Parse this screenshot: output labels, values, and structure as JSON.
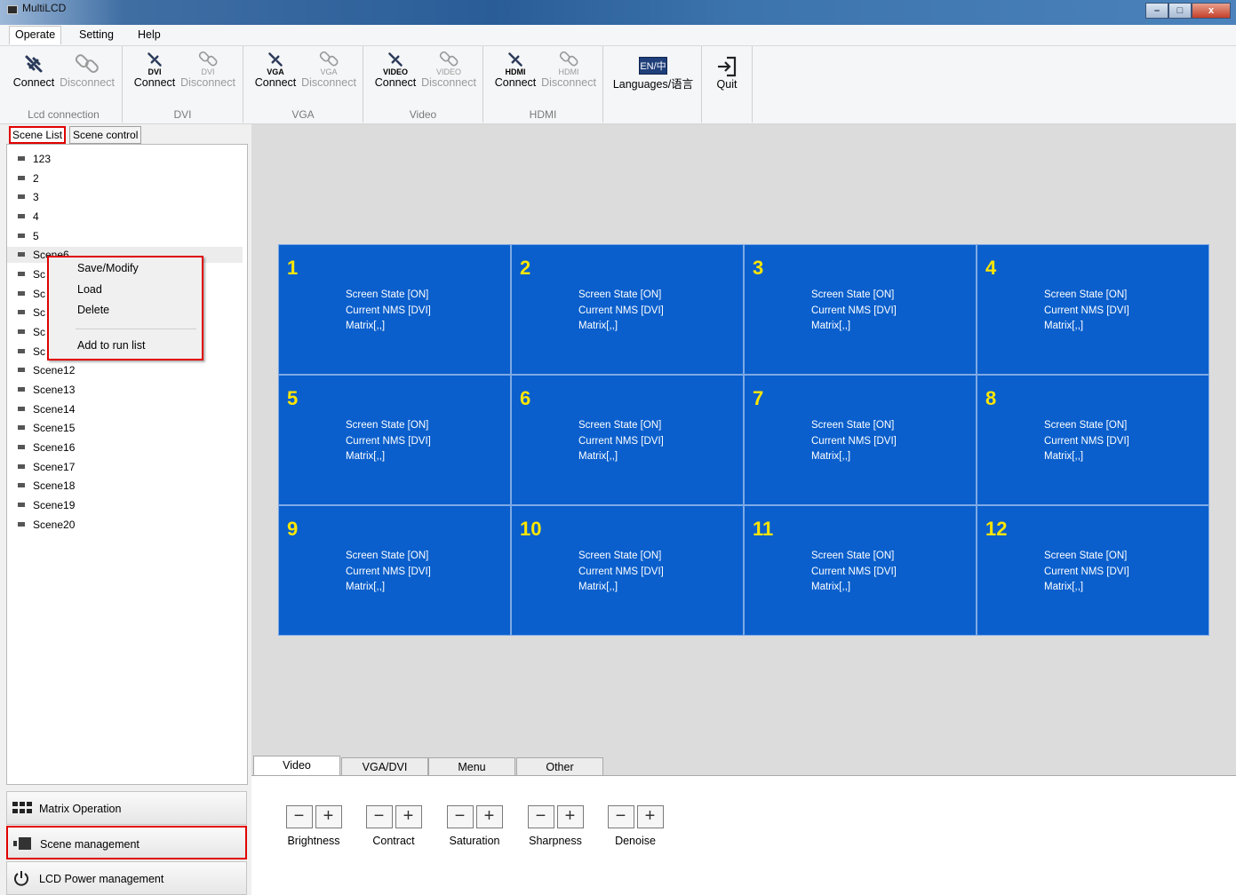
{
  "window": {
    "title": "MultiLCD",
    "min": "–",
    "max": "□",
    "close": "x"
  },
  "menu": {
    "items": [
      "Operate",
      "Setting",
      "Help"
    ]
  },
  "ribbon": {
    "groups": [
      {
        "label": "Lcd connection",
        "connect": "Connect",
        "disconnect": "Disconnect",
        "sub": ""
      },
      {
        "label": "DVI",
        "connect": "Connect",
        "disconnect": "Disconnect",
        "sub": "DVI"
      },
      {
        "label": "VGA",
        "connect": "Connect",
        "disconnect": "Disconnect",
        "sub": "VGA"
      },
      {
        "label": "Video",
        "connect": "Connect",
        "disconnect": "Disconnect",
        "sub": "VIDEO"
      },
      {
        "label": "HDMI",
        "connect": "Connect",
        "disconnect": "Disconnect",
        "sub": "HDMI"
      }
    ],
    "languages": {
      "icon_text": "EN/中",
      "label": "Languages/语言"
    },
    "quit": {
      "label": "Quit"
    }
  },
  "left_tabs": {
    "scene_list": "Scene List",
    "scene_control": "Scene control"
  },
  "scenes": [
    "123",
    "2",
    "3",
    "4",
    "5",
    "Scene6",
    "Sc",
    "Sc",
    "Sc",
    "Sc",
    "Sc",
    "Scene12",
    "Scene13",
    "Scene14",
    "Scene15",
    "Scene16",
    "Scene17",
    "Scene18",
    "Scene19",
    "Scene20"
  ],
  "context_menu": {
    "save": "Save/Modify",
    "load": "Load",
    "delete": "Delete",
    "add_run": "Add to run list"
  },
  "nav": {
    "matrix": "Matrix Operation",
    "scene": "Scene management",
    "power": "LCD Power management"
  },
  "screen": {
    "state_text": "Screen State [ON]",
    "nms_text": "Current NMS [DVI]",
    "matrix_text": "Matrix[,,]",
    "cells": [
      "1",
      "2",
      "3",
      "4",
      "5",
      "6",
      "7",
      "8",
      "9",
      "10",
      "11",
      "12"
    ]
  },
  "bottom_tabs": [
    "Video",
    "VGA/DVI",
    "Menu",
    "Other"
  ],
  "controls": {
    "minus": "−",
    "plus": "+",
    "labels": [
      "Brightness",
      "Contract",
      "Saturation",
      "Sharpness",
      "Denoise"
    ]
  },
  "colors": {
    "cell_blue": "#0a5fcc",
    "cell_number": "#ffe600",
    "highlight_red": "#e00000"
  }
}
